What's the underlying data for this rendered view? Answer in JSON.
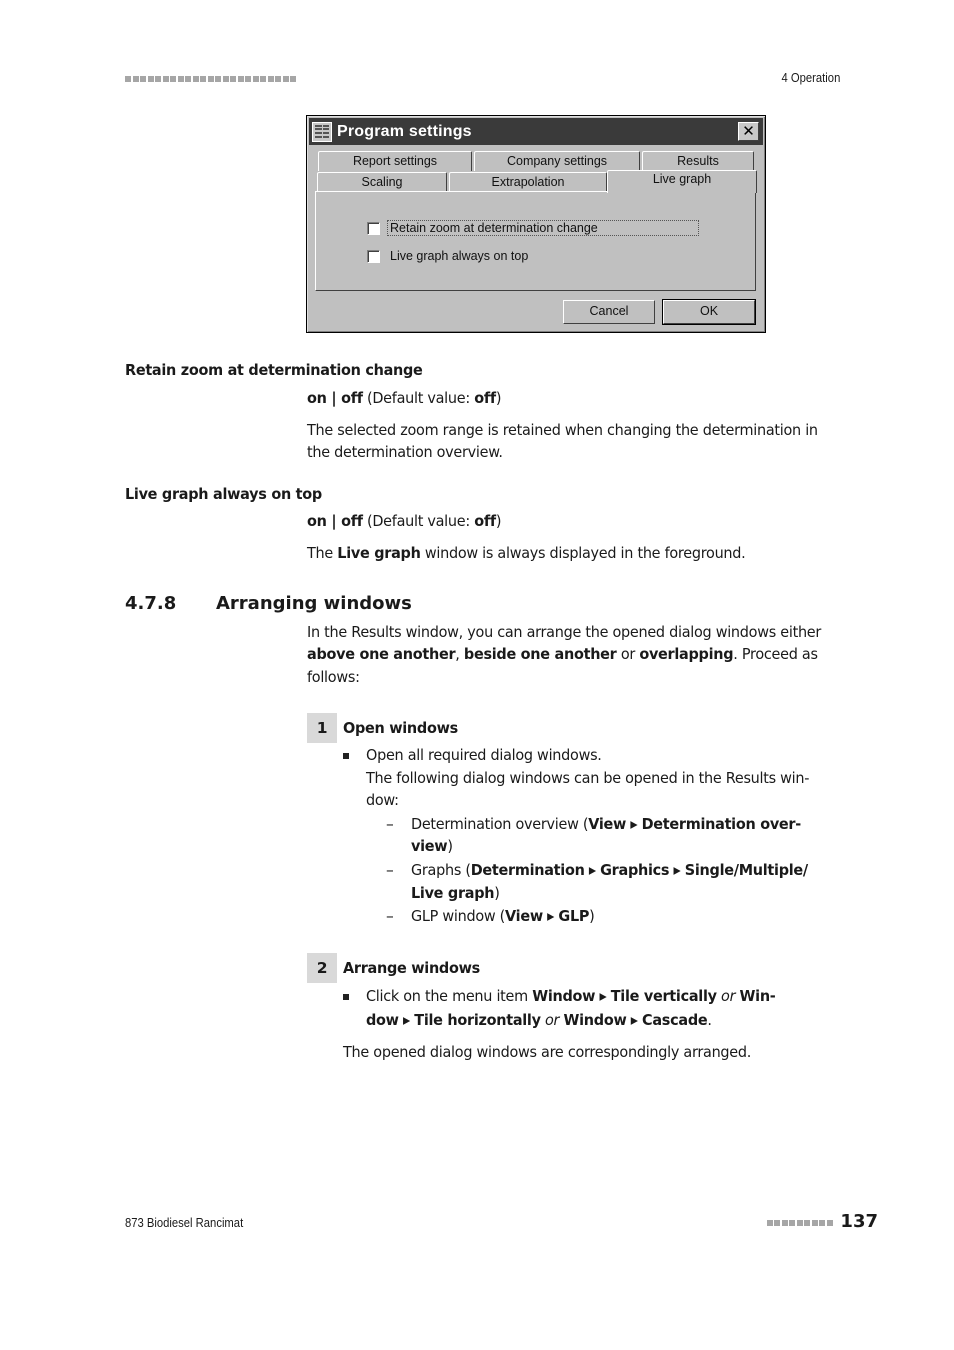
{
  "header": {
    "chapter": "4 Operation"
  },
  "dialog": {
    "title": "Program settings",
    "tabs_row1": [
      "Report settings",
      "Company settings",
      "Results"
    ],
    "tabs_row2": [
      "Scaling",
      "Extrapolation",
      "Live graph"
    ],
    "active_tab": "Live graph",
    "checkboxes": [
      {
        "label": "Retain zoom at determination change",
        "checked": false
      },
      {
        "label": "Live graph always on top",
        "checked": false
      }
    ],
    "cancel_label": "Cancel",
    "ok_label": "OK"
  },
  "params": [
    {
      "title": "Retain zoom at determination change",
      "on": "on",
      "sep": " | ",
      "off": "off",
      "default_prefix": " (Default value: ",
      "default_value": "off",
      "default_suffix": ")",
      "desc1": "The selected zoom range is retained when changing the determination in",
      "desc2": "the determination overview."
    },
    {
      "title": "Live graph always on top",
      "on": "on",
      "sep": " | ",
      "off": "off",
      "default_prefix": " (Default value: ",
      "default_value": "off",
      "default_suffix": ")",
      "desc_pre": "The ",
      "desc_bold": "Live graph",
      "desc_post": " window is always displayed in the foreground."
    }
  ],
  "section": {
    "number": "4.7.8",
    "title": "Arranging windows",
    "intro_line1": "In the Results window, you can arrange the opened dialog windows either",
    "intro_b1": "above one another",
    "intro_c1": ", ",
    "intro_b2": "beside one another",
    "intro_c2": " or ",
    "intro_b3": "overlapping",
    "intro_c3": ". Proceed as",
    "intro_line3": "follows:"
  },
  "steps": [
    {
      "number": "1",
      "title": "Open windows",
      "bullet": "Open all required dialog windows.",
      "note1": "The following dialog windows can be opened in the Results win-",
      "note2": "dow:",
      "subs": [
        {
          "pre": "Determination overview (",
          "b1": "View",
          "arrow": " ▸ ",
          "b2": "Determination over-",
          "l2b": "view",
          "l2post": ")"
        },
        {
          "pre": "Graphs (",
          "b1": "Determination",
          "b2": "Graphics",
          "b3": "Single/Multiple/",
          "l2b": "Live graph",
          "l2post": ")"
        },
        {
          "pre": "GLP window (",
          "b1": "View",
          "b2": "GLP",
          "post": ")"
        }
      ],
      "dash": "–"
    },
    {
      "number": "2",
      "title": "Arrange windows",
      "l1_pre": "Click on the menu item ",
      "l1_b1": "Window",
      "l1_b2": "Tile vertically",
      "l1_or": " or ",
      "l1_b3": "Win-",
      "l2_b1": "dow",
      "l2_b2": "Tile horizontally",
      "l2_or": " or ",
      "l2_b3": "Window",
      "l2_b4": "Cascade",
      "l2_end": ".",
      "result": "The opened dialog windows are correspondingly arranged."
    }
  ],
  "arrow": " ▸ ",
  "footer": {
    "product": "873 Biodiesel Rancimat",
    "page": "137"
  }
}
